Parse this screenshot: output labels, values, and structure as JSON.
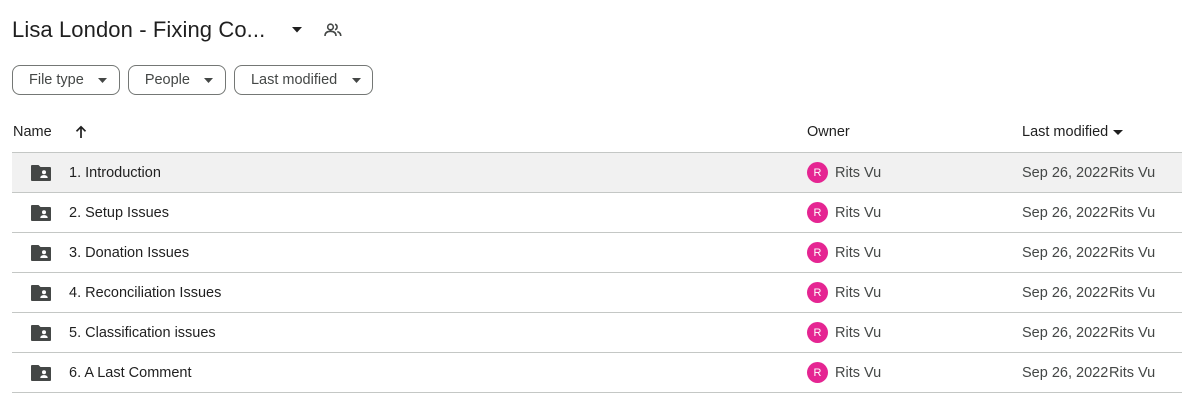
{
  "header": {
    "title": "Lisa London - Fixing Co...",
    "title_caret_icon": "arrow-drop-down-icon",
    "shared_icon": "people-icon"
  },
  "filters": [
    {
      "label": "File type",
      "icon": "arrow-drop-down-icon"
    },
    {
      "label": "People",
      "icon": "arrow-drop-down-icon"
    },
    {
      "label": "Last modified",
      "icon": "arrow-drop-down-icon"
    }
  ],
  "table": {
    "columns": {
      "name": "Name",
      "name_sort_icon": "arrow-upward-icon",
      "owner": "Owner",
      "modified": "Last modified",
      "modified_sort_icon": "arrow-drop-down-icon"
    },
    "rows": [
      {
        "name": "1. Introduction",
        "owner_initial": "R",
        "owner": "Rits Vu",
        "modified_date": "Sep 26, 2022",
        "modified_by": "Rits Vu",
        "icon": "shared-folder-icon"
      },
      {
        "name": "2. Setup Issues",
        "owner_initial": "R",
        "owner": "Rits Vu",
        "modified_date": "Sep 26, 2022",
        "modified_by": "Rits Vu",
        "icon": "shared-folder-icon"
      },
      {
        "name": "3. Donation Issues",
        "owner_initial": "R",
        "owner": "Rits Vu",
        "modified_date": "Sep 26, 2022",
        "modified_by": "Rits Vu",
        "icon": "shared-folder-icon"
      },
      {
        "name": "4. Reconciliation Issues",
        "owner_initial": "R",
        "owner": "Rits Vu",
        "modified_date": "Sep 26, 2022",
        "modified_by": "Rits Vu",
        "icon": "shared-folder-icon"
      },
      {
        "name": "5. Classification issues",
        "owner_initial": "R",
        "owner": "Rits Vu",
        "modified_date": "Sep 26, 2022",
        "modified_by": "Rits Vu",
        "icon": "shared-folder-icon"
      },
      {
        "name": "6. A Last Comment",
        "owner_initial": "R",
        "owner": "Rits Vu",
        "modified_date": "Sep 26, 2022",
        "modified_by": "Rits Vu",
        "icon": "shared-folder-icon"
      }
    ]
  },
  "colors": {
    "avatar_bg": "#e52592",
    "selected_row_bg": "#f1f1f1",
    "divider": "#c4c7c5"
  }
}
